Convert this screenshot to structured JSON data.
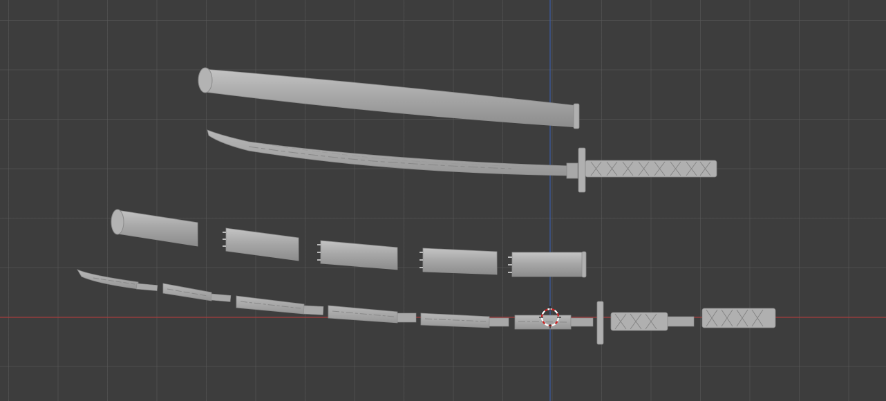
{
  "viewport": {
    "background_color": "#3d3d3d",
    "grid_color": "#5a5a5a",
    "x_axis_color": "#a63a3a",
    "z_axis_color": "#3d5ea6",
    "mesh_color": "#a6a6a6"
  },
  "scene": {
    "objects": [
      "saya-scabbard",
      "katana-assembled",
      "saya-segment-1",
      "saya-segment-2",
      "saya-segment-3",
      "saya-segment-4",
      "saya-segment-5",
      "blade-segment-1",
      "blade-segment-2",
      "blade-segment-3",
      "blade-segment-4",
      "blade-segment-5",
      "blade-segment-6",
      "habaki-segment",
      "tsuba-guard",
      "tsuka-segment-1",
      "tsuka-segment-2"
    ],
    "cursor_icon": "3d-cursor-icon"
  }
}
